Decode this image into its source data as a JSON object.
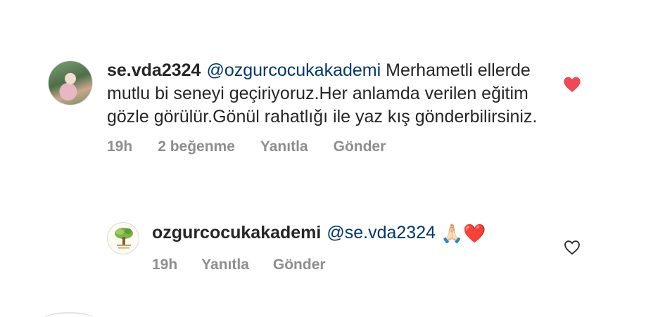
{
  "comment": {
    "username": "se.vda2324",
    "mention": "@ozgurcocukakademi",
    "text": "Merhametli ellerde mutlu bi seneyi geçiriyoruz.Her anlamda verilen eğitim gözle görülür.Gönül rahatlığı ile yaz kış gönderbilirsiniz.",
    "time": "19h",
    "likes": "2 beğenme",
    "reply_label": "Yanıtla",
    "send_label": "Gönder",
    "liked": true,
    "like_color": "#ed4956"
  },
  "reply": {
    "username": "ozgurcocukakademi",
    "mention": "@se.vda2324",
    "emojis": "🙏🏻❤️",
    "time": "19h",
    "reply_label": "Yanıtla",
    "send_label": "Gönder",
    "liked": false
  },
  "colors": {
    "text": "#262626",
    "mention": "#00376b",
    "meta": "#8e8e8e"
  }
}
